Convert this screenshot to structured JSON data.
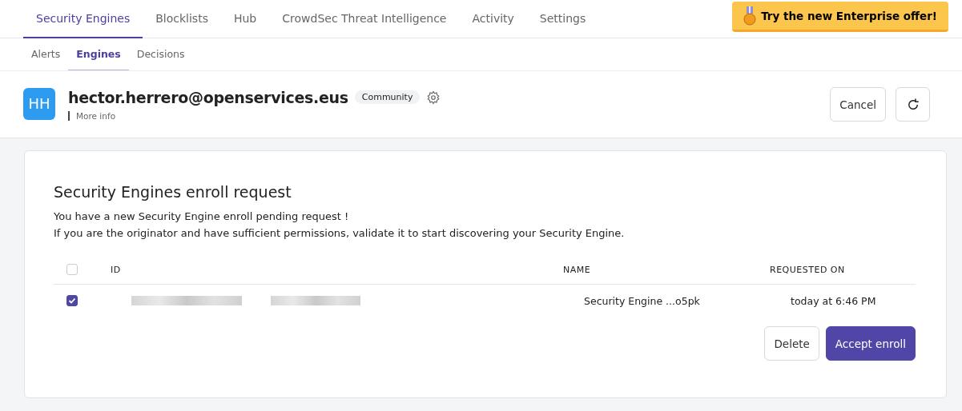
{
  "tabs": [
    {
      "label": "Security Engines",
      "selected": true
    },
    {
      "label": "Blocklists",
      "selected": false
    },
    {
      "label": "Hub",
      "selected": false
    },
    {
      "label": "CrowdSec Threat Intelligence",
      "selected": false
    },
    {
      "label": "Activity",
      "selected": false
    },
    {
      "label": "Settings",
      "selected": false
    }
  ],
  "promo_button": "Try the new Enterprise offer!",
  "subtabs": [
    {
      "label": "Alerts",
      "selected": false
    },
    {
      "label": "Engines",
      "selected": true
    },
    {
      "label": "Decisions",
      "selected": false
    }
  ],
  "account": {
    "initials": "HH",
    "email": "hector.herrero@openservices.eus",
    "plan": "Community",
    "more_info": "More info"
  },
  "actions": {
    "cancel": "Cancel"
  },
  "card": {
    "title": "Security Engines enroll request",
    "lines": [
      "You have a new Security Engine enroll pending request !",
      "If you are the originator and have sufficient permissions, validate it to start discovering your Security Engine."
    ],
    "table": {
      "select_all": {
        "checked": false
      },
      "columns": [
        "ID",
        "NAME",
        "REQUESTED ON"
      ],
      "rows": [
        {
          "checked": true,
          "name": "Security Engine ...o5pk",
          "requested_on": "today at 6:46 PM"
        }
      ]
    },
    "buttons": {
      "delete": "Delete",
      "accept": "Accept enroll"
    }
  }
}
